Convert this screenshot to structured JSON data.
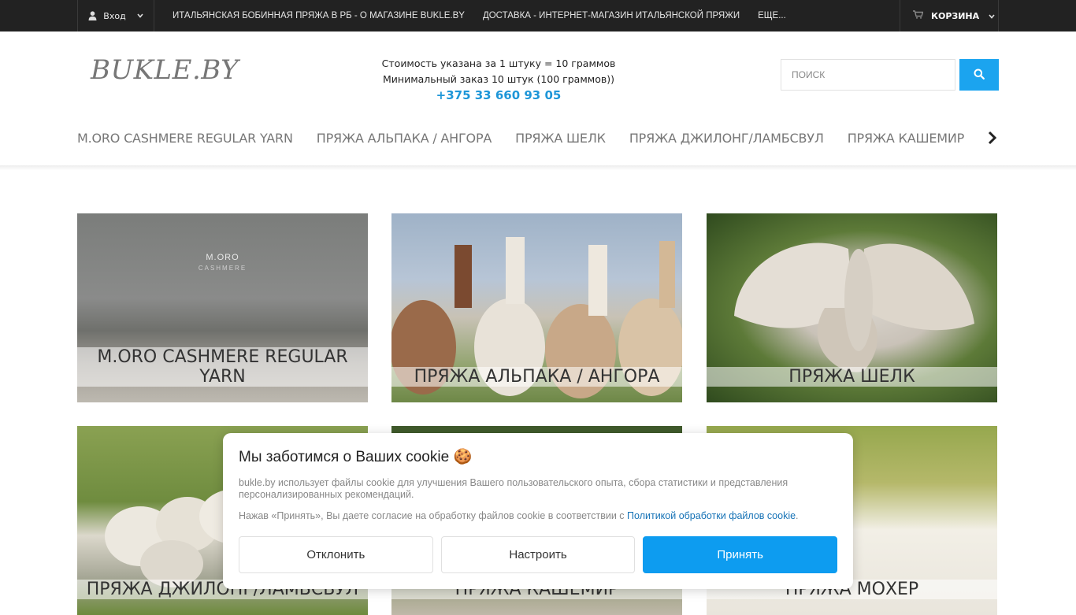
{
  "topbar": {
    "login_label": "Вход",
    "links": [
      "ИТАЛЬЯНСКАЯ БОБИННАЯ ПРЯЖА В РБ - О МАГАЗИНЕ BUKLE.BY",
      "ДОСТАВКА - ИНТЕРНЕТ-МАГАЗИН ИТАЛЬЯНСКОЙ ПРЯЖИ",
      "ЕЩЕ..."
    ],
    "cart_label": "КОРЗИНА"
  },
  "header": {
    "logo_text": "BUKLE.BY",
    "info_line1": "Стоимость указана за 1 штуку = 10 граммов",
    "info_line2": "Минимальный заказ 10 штук (100 граммов))",
    "phone": "+375 33 660 93 05",
    "search_placeholder": "ПОИСК"
  },
  "nav": {
    "items": [
      "M.ORO CASHMERE REGULAR YARN",
      "ПРЯЖА АЛЬПАКА / АНГОРА",
      "ПРЯЖА ШЕЛК",
      "ПРЯЖА ДЖИЛОНГ/ЛАМБСВУЛ",
      "ПРЯЖА КАШЕМИР"
    ]
  },
  "tiles": {
    "t1": {
      "caption": "M.ORO CASHMERE REGULAR YARN",
      "image_text": "M.ORO",
      "image_subtext": "CASHMERE"
    },
    "t2": {
      "caption": "ПРЯЖА АЛЬПАКА / АНГОРА"
    },
    "t3": {
      "caption": "ПРЯЖА ШЕЛК"
    },
    "t4": {
      "caption": "ПРЯЖА ДЖИЛОНГ/ЛАМБСВУЛ"
    },
    "t5": {
      "caption": "ПРЯЖА КАШЕМИР"
    },
    "t6": {
      "caption": "ПРЯЖА МОХЕР"
    }
  },
  "cookie": {
    "title": "Мы заботимся о Ваших cookie 🍪",
    "text": "bukle.by использует файлы cookie для улучшения Вашего пользовательского опыта, сбора статистики и представления персонализированных рекомендаций.",
    "consent_text": "Нажав «Принять», Вы даете согласие на обработку файлов cookie в соответствии с ",
    "policy_link": "Политикой обработки файлов cookie",
    "consent_end": ".",
    "decline_label": "Отклонить",
    "configure_label": "Настроить",
    "accept_label": "Принять"
  },
  "colors": {
    "topbar_bg": "#222222",
    "accent": "#1BA4EF",
    "phone": "#1E96D8",
    "link": "#1572B6",
    "accept_button": "#0D9CF0"
  },
  "icons": {
    "login": "user-icon",
    "login_dropdown": "chevron-down-icon",
    "cart": "cart-icon",
    "cart_dropdown": "chevron-down-icon",
    "search": "search-icon",
    "nav_next": "chevron-right-icon"
  }
}
